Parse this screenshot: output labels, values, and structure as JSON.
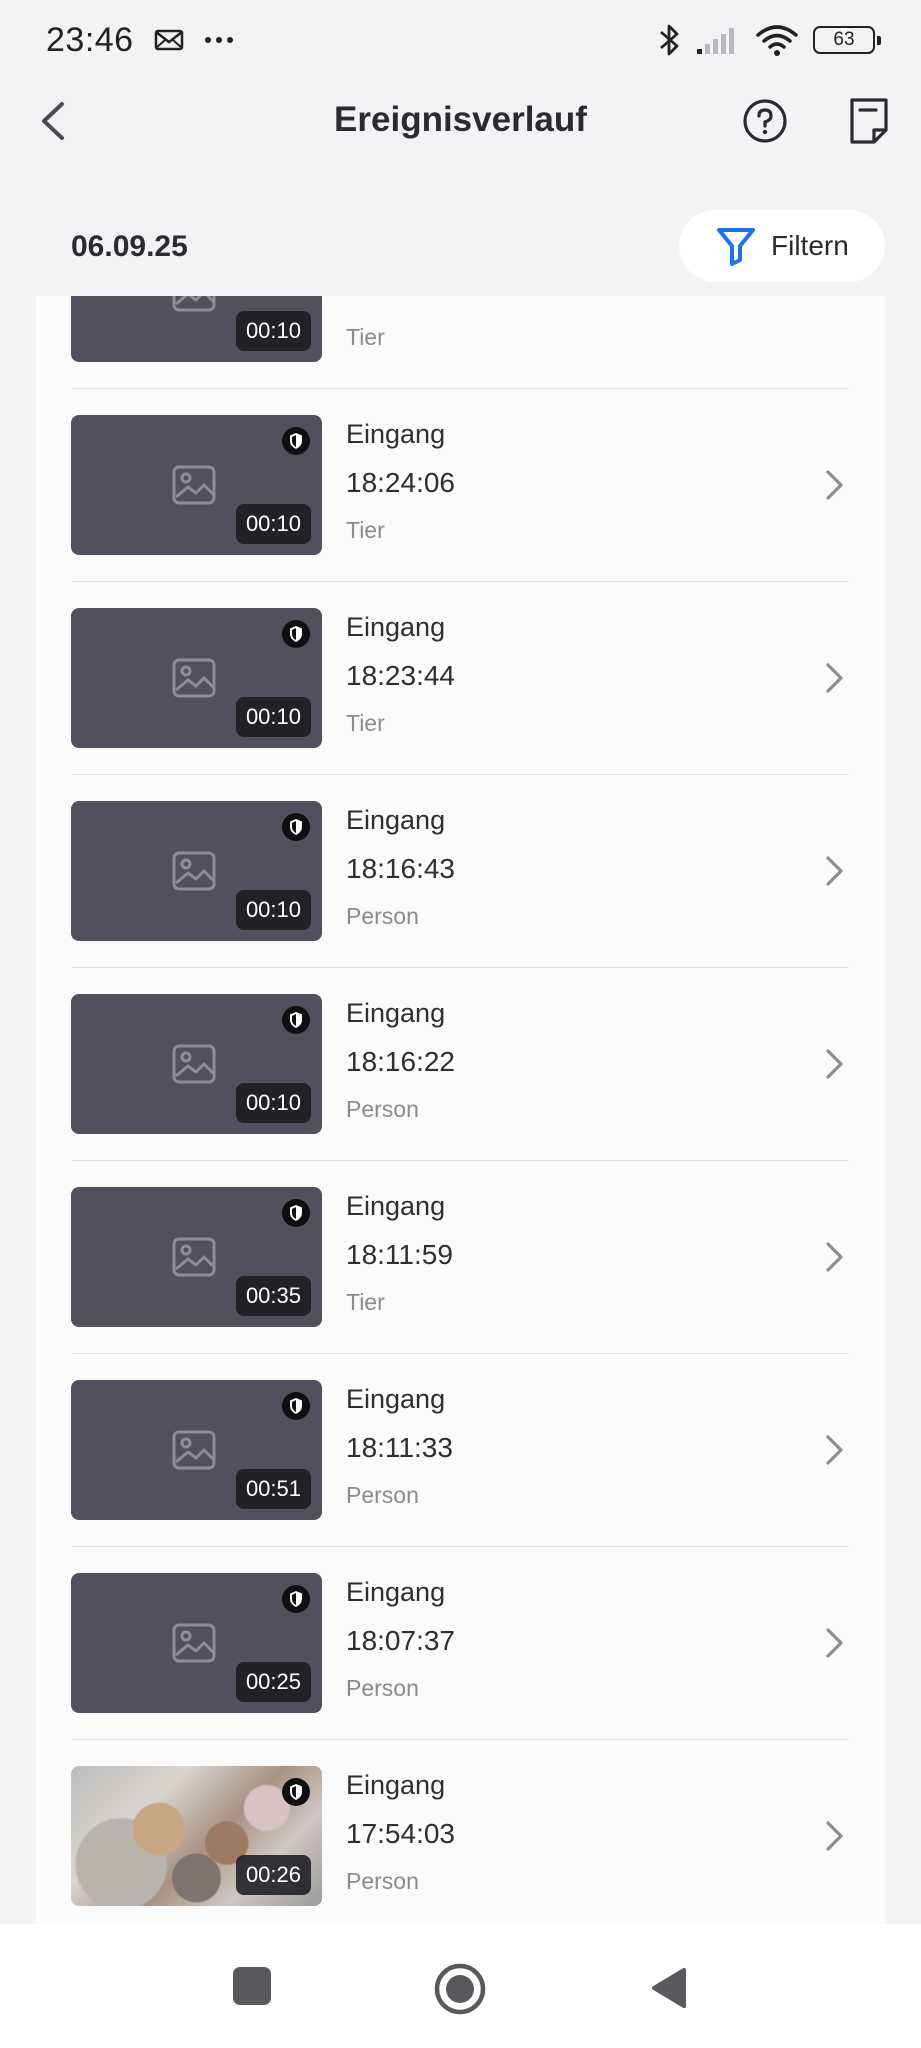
{
  "status_bar": {
    "time": "23:46",
    "left_icons": [
      "mail-icon",
      "more-dots-icon"
    ],
    "right_icons": [
      "bluetooth-icon",
      "signal-icon",
      "wifi-icon"
    ],
    "battery": "63"
  },
  "header": {
    "title": "Ereignisverlauf",
    "back_icon": "chevron-left-icon",
    "help_icon": "help-circle-icon",
    "report_icon": "report-icon"
  },
  "date_section": {
    "date": "06.09.25",
    "filter_label": "Filtern",
    "filter_icon": "filter-icon"
  },
  "events": [
    {
      "name": "",
      "time": "",
      "type": "Tier",
      "duration": "00:10",
      "thumbnail": "placeholder"
    },
    {
      "name": "Eingang",
      "time": "18:24:06",
      "type": "Tier",
      "duration": "00:10",
      "thumbnail": "placeholder"
    },
    {
      "name": "Eingang",
      "time": "18:23:44",
      "type": "Tier",
      "duration": "00:10",
      "thumbnail": "placeholder"
    },
    {
      "name": "Eingang",
      "time": "18:16:43",
      "type": "Person",
      "duration": "00:10",
      "thumbnail": "placeholder"
    },
    {
      "name": "Eingang",
      "time": "18:16:22",
      "type": "Person",
      "duration": "00:10",
      "thumbnail": "placeholder"
    },
    {
      "name": "Eingang",
      "time": "18:11:59",
      "type": "Tier",
      "duration": "00:35",
      "thumbnail": "placeholder"
    },
    {
      "name": "Eingang",
      "time": "18:11:33",
      "type": "Person",
      "duration": "00:51",
      "thumbnail": "placeholder"
    },
    {
      "name": "Eingang",
      "time": "18:07:37",
      "type": "Person",
      "duration": "00:25",
      "thumbnail": "placeholder"
    },
    {
      "name": "Eingang",
      "time": "17:54:03",
      "type": "Person",
      "duration": "00:26",
      "thumbnail": "camera-snapshot"
    }
  ],
  "nav_bar": {
    "items": [
      "recents-square-icon",
      "home-circle-icon",
      "back-triangle-icon"
    ]
  },
  "colors": {
    "background": "#f2f3f5",
    "card": "#fbfbfc",
    "thumbnail": "#50505e",
    "accent_filter": "#1a73e8",
    "secondary_text": "#8a8a90"
  }
}
